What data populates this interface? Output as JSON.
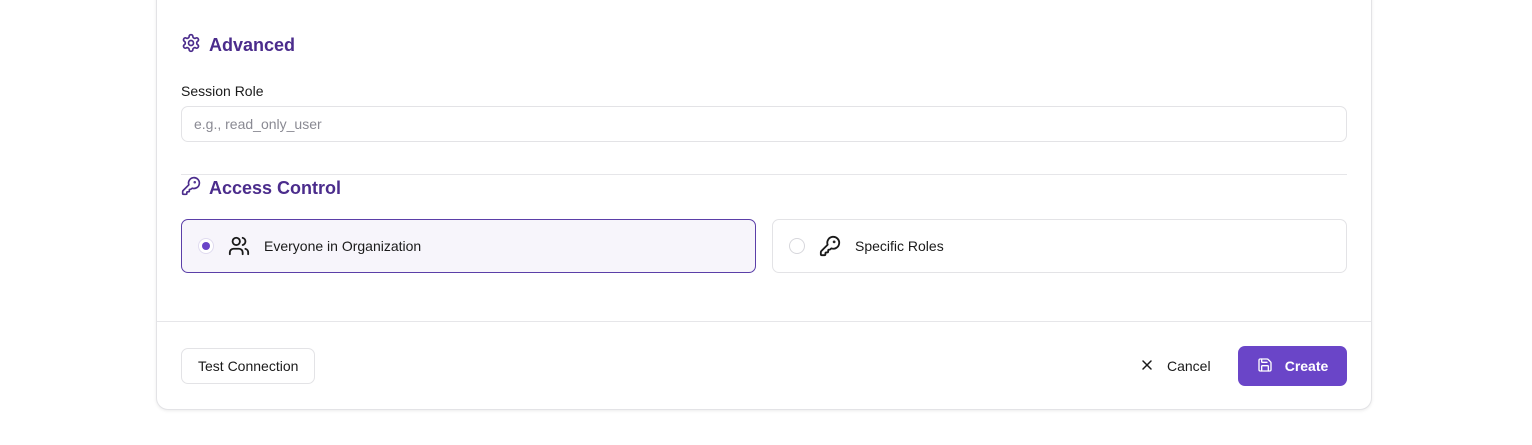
{
  "advanced": {
    "heading": "Advanced",
    "session_role_label": "Session Role",
    "session_role_placeholder": "e.g., read_only_user",
    "session_role_value": ""
  },
  "access_control": {
    "heading": "Access Control",
    "options": [
      {
        "label": "Everyone in Organization",
        "icon": "users-icon",
        "selected": true
      },
      {
        "label": "Specific Roles",
        "icon": "key-icon",
        "selected": false
      }
    ]
  },
  "footer": {
    "test_connection_label": "Test Connection",
    "cancel_label": "Cancel",
    "create_label": "Create"
  },
  "colors": {
    "accent": "#6a45c8",
    "heading": "#4b2c8c"
  }
}
